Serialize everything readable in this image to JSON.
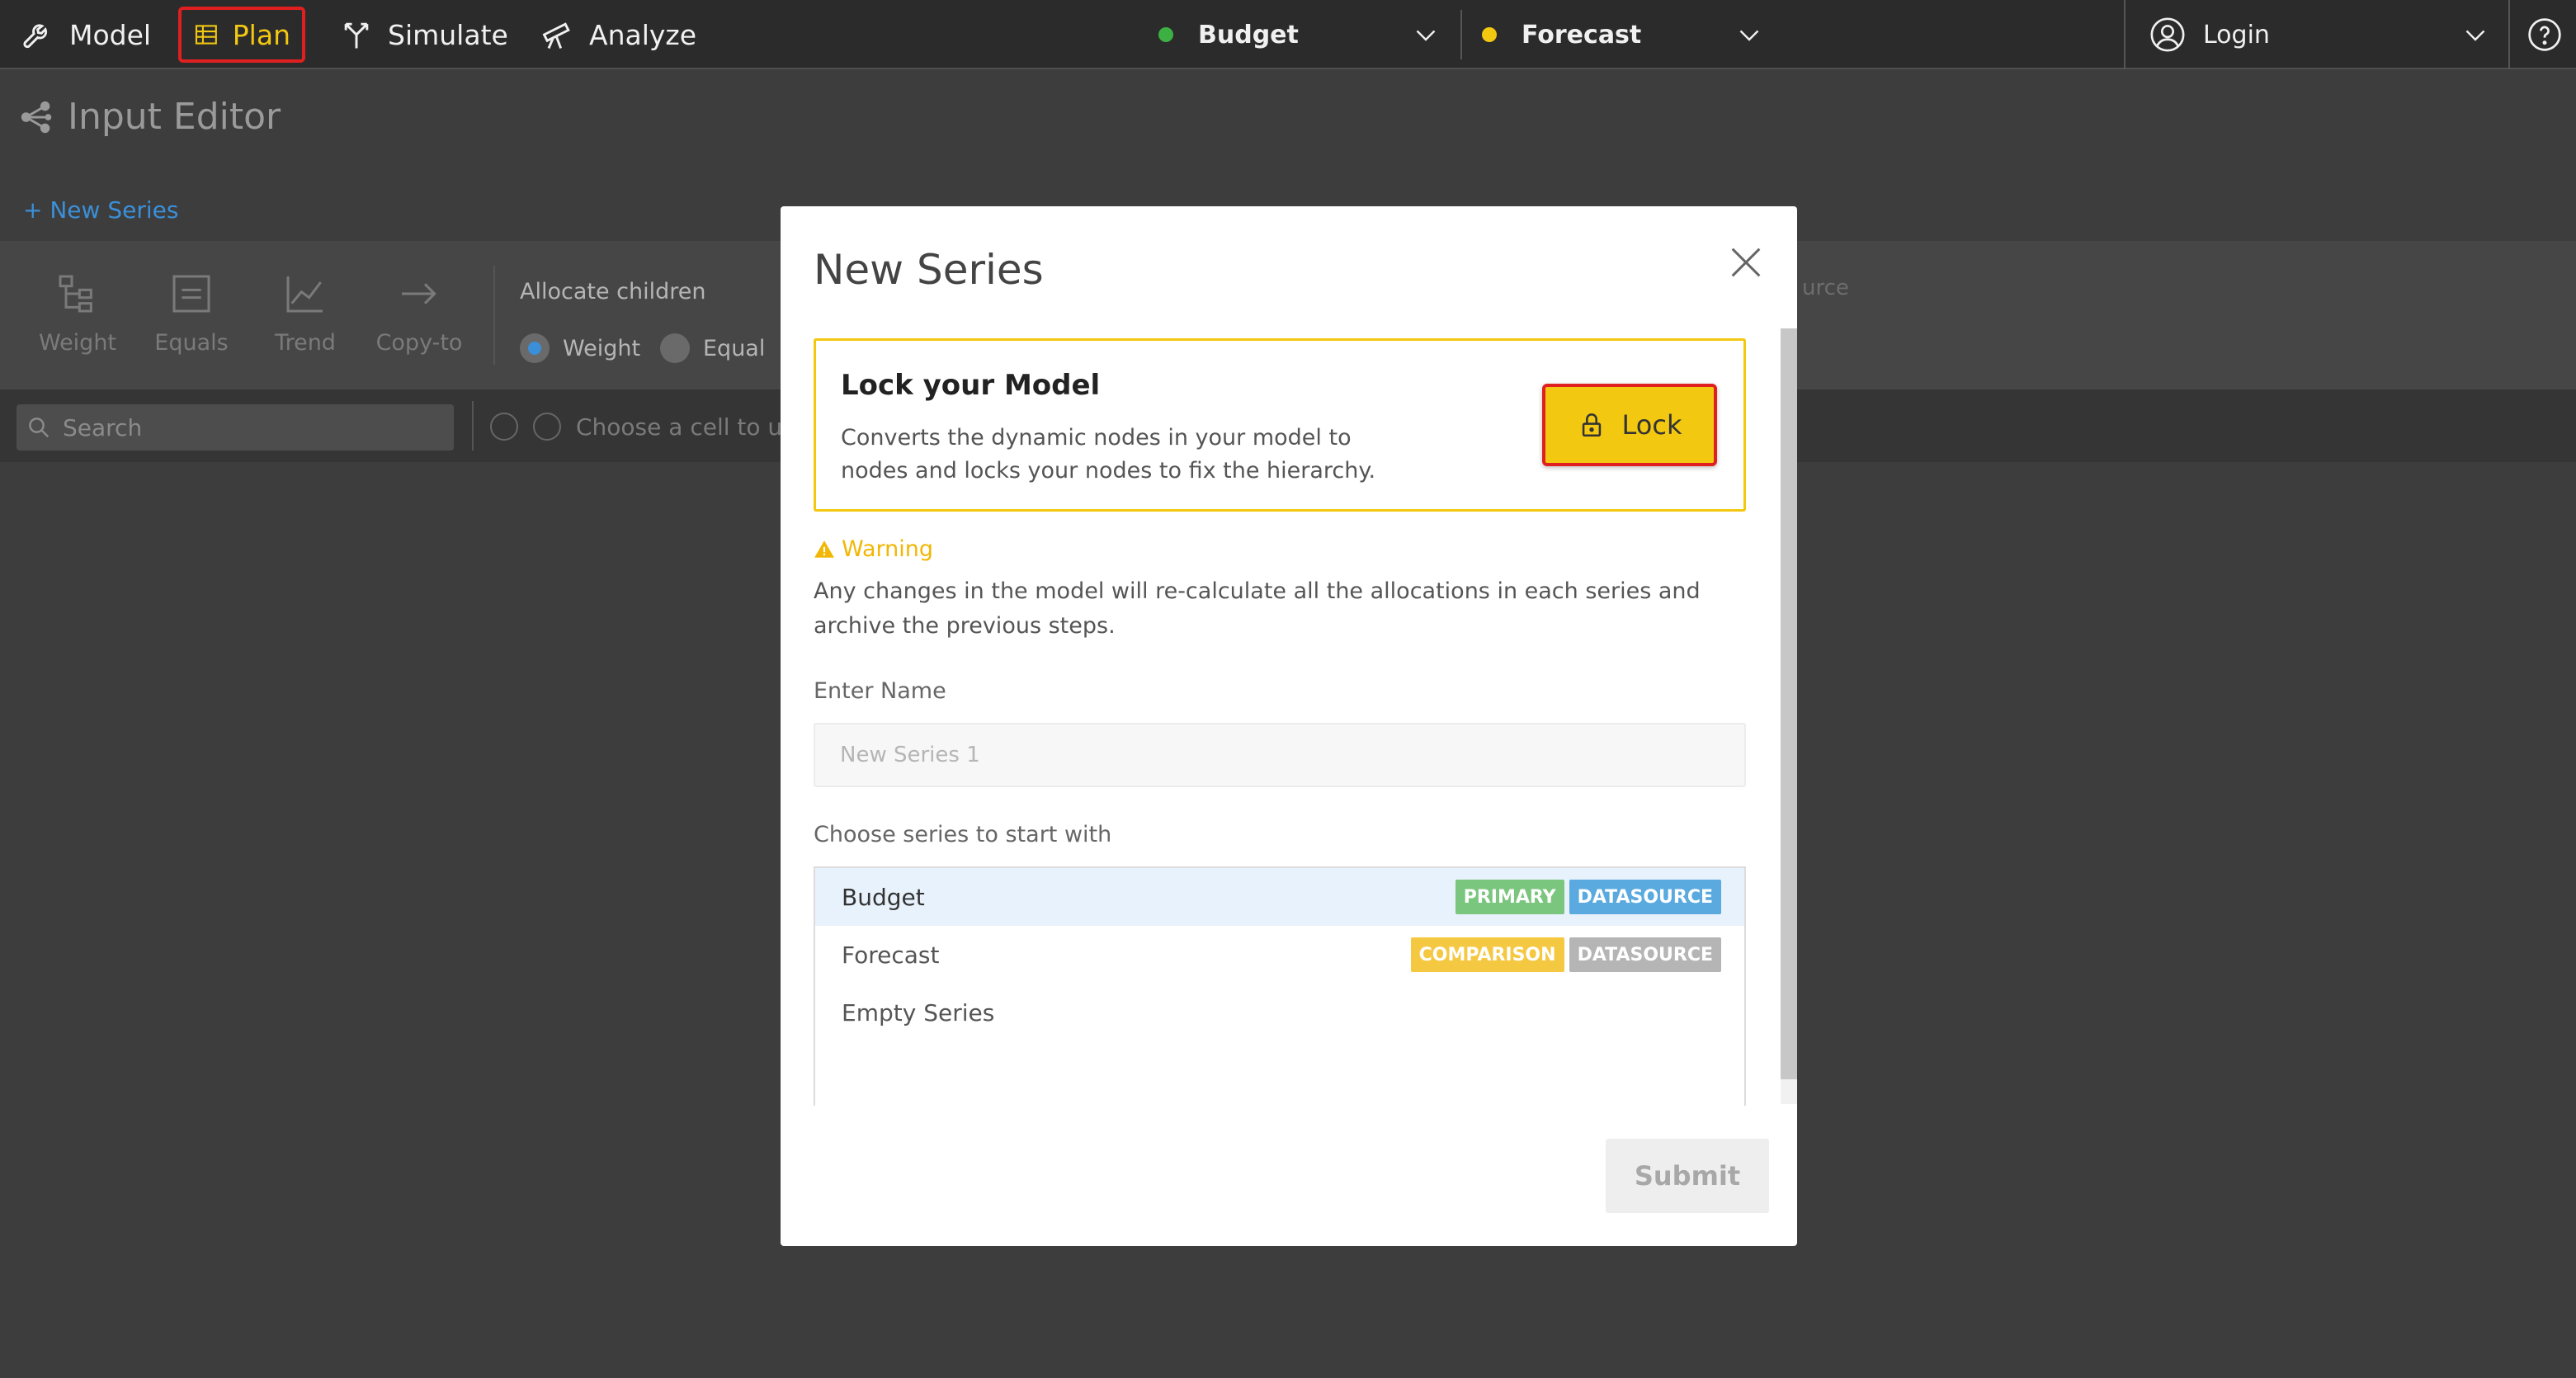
{
  "nav": {
    "items": [
      {
        "label": "Model",
        "icon": "wrench-icon"
      },
      {
        "label": "Plan",
        "icon": "table-icon"
      },
      {
        "label": "Simulate",
        "icon": "branch-icon"
      },
      {
        "label": "Analyze",
        "icon": "telescope-icon"
      }
    ],
    "active_color": "#f2c811",
    "highlight_color": "#e02020"
  },
  "series_selectors": [
    {
      "label": "Budget",
      "color": "#3cb043"
    },
    {
      "label": "Forecast",
      "color": "#f2c811"
    }
  ],
  "user": {
    "label": "Login"
  },
  "help_icon": "help-icon",
  "page": {
    "title": "Input Editor",
    "new_series_link": "+ New Series",
    "tools": [
      "Weight",
      "Equals",
      "Trend",
      "Copy-to"
    ],
    "allocate_label": "Allocate children",
    "allocate_options": [
      "Weight",
      "Equal"
    ],
    "search_placeholder": "Search",
    "hint_text": "Choose a cell to u",
    "behind_modal_text": "urce"
  },
  "modal": {
    "title": "New Series",
    "lock_card": {
      "title": "Lock your Model",
      "description": "Converts the dynamic nodes in your model to nodes and locks your nodes to fix the hierarchy.",
      "button_label": "Lock"
    },
    "warning": {
      "title": "Warning",
      "text": "Any changes in the model will re-calculate all the allocations in each series and archive the previous steps."
    },
    "name_label": "Enter Name",
    "name_placeholder": "New Series 1",
    "choose_label": "Choose series to start with",
    "series_options": [
      {
        "label": "Budget",
        "badges": [
          {
            "text": "PRIMARY",
            "color": "#7bc67e"
          },
          {
            "text": "DATASOURCE",
            "color": "#5aaae0"
          }
        ]
      },
      {
        "label": "Forecast",
        "badges": [
          {
            "text": "COMPARISON",
            "color": "#f5c842"
          },
          {
            "text": "DATASOURCE",
            "color": "#b5b5b5"
          }
        ]
      },
      {
        "label": "Empty Series",
        "badges": []
      }
    ],
    "submit_label": "Submit"
  }
}
